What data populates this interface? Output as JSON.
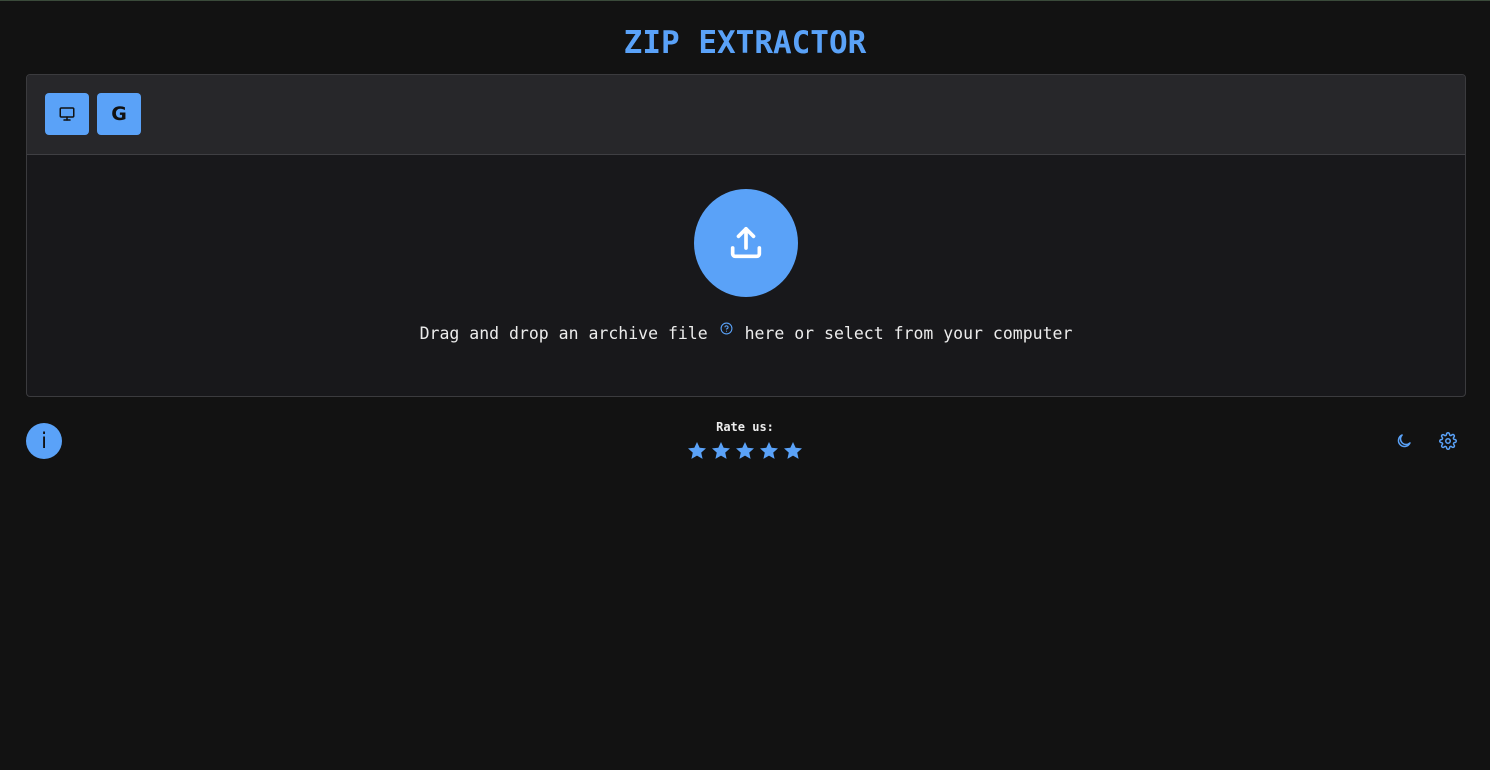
{
  "app": {
    "title": "ZIP EXTRACTOR"
  },
  "sources": [
    {
      "name": "Local computer",
      "icon": "monitor-icon"
    },
    {
      "name": "Google Drive",
      "icon": "google-g-icon",
      "glyph": "G"
    }
  ],
  "dropzone": {
    "text_before": "Drag and drop an archive file",
    "text_after": "here or select from your computer",
    "upload_icon": "upload-icon",
    "help_icon": "question-circle-icon"
  },
  "footer": {
    "info_label": "i",
    "rate_label": "Rate us:",
    "rating_max": 5,
    "theme_icon": "moon-icon",
    "settings_icon": "gear-icon"
  },
  "colors": {
    "accent": "#5aa2f8",
    "background": "#121212",
    "panel": "#18181b",
    "panel_header": "#27272a",
    "text": "#ececec"
  }
}
